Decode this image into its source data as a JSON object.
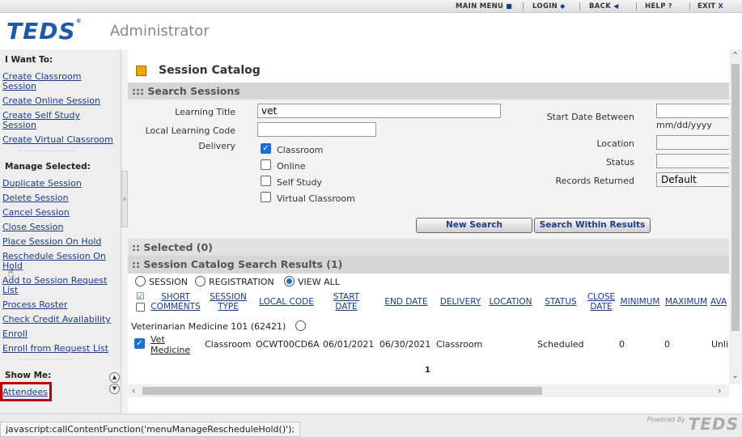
{
  "topnav": {
    "main_menu": "MAIN MENU",
    "logout": "LOGIN",
    "back": "BACK",
    "help": "HELP",
    "exit": "EXIT"
  },
  "header": {
    "logo": "TEDS",
    "subtitle": "Administrator"
  },
  "sidebar": {
    "i_want_to": "I Want To:",
    "create_items": [
      {
        "label": "Create Classroom Session"
      },
      {
        "label": "Create Online Session"
      },
      {
        "label": "Create Self Study Session"
      },
      {
        "label": "Create Virtual Classroom"
      }
    ],
    "dots": "..................",
    "manage_selected": "Manage Selected:",
    "manage_items": [
      {
        "label": "Duplicate Session"
      },
      {
        "label": "Delete Session"
      },
      {
        "label": "Cancel Session"
      },
      {
        "label": "Close Session"
      },
      {
        "label": "Place Session On Hold"
      },
      {
        "label": "Reschedule Session On Hold"
      },
      {
        "label": "Add to Session Request List"
      },
      {
        "label": "Process Roster"
      },
      {
        "label": "Check Credit Availability"
      },
      {
        "label": "Enroll"
      },
      {
        "label": "Enroll from Request List"
      }
    ],
    "show_me": "Show Me:",
    "show_items": [
      {
        "label": "Attendees"
      }
    ]
  },
  "main": {
    "title": "Session Catalog",
    "search_bar": "::: Search Sessions",
    "learning_title_label": "Learning Title",
    "learning_title_value": "vet",
    "local_code_label": "Local Learning Code",
    "local_code_value": "",
    "delivery_label": "Delivery",
    "delivery_options": [
      {
        "label": "Classroom",
        "checked": true
      },
      {
        "label": "Online",
        "checked": false
      },
      {
        "label": "Self Study",
        "checked": false
      },
      {
        "label": "Virtual Classroom",
        "checked": false
      }
    ],
    "start_date_label": "Start Date Between",
    "date_format": "mm/dd/yyyy",
    "location_label": "Location",
    "status_label": "Status",
    "records_label": "Records Returned",
    "records_value": "Default",
    "new_search": "New Search",
    "search_within": "Search Within Results",
    "selected_bar": ":: Selected (0)",
    "results_bar": ":: Session Catalog Search Results (1)",
    "view_options": [
      {
        "label": "SESSION",
        "selected": false
      },
      {
        "label": "REGISTRATION",
        "selected": false
      },
      {
        "label": "VIEW ALL",
        "selected": true
      }
    ],
    "columns": {
      "short_comments": "SHORT COMMENTS",
      "session_type": "SESSION TYPE",
      "local_code": "LOCAL CODE",
      "start_date": "START DATE",
      "end_date": "END DATE",
      "delivery": "DELIVERY",
      "location": "LOCATION",
      "status": "STATUS",
      "close_date": "CLOSE DATE",
      "minimum": "MINIMUM",
      "maximum": "MAXIMUM",
      "available": "AVA"
    },
    "group_label": "Veterinarian Medicine 101 (62421)",
    "row": {
      "title": "Vet Medicine",
      "session_type": "Classroom",
      "local_code": "OCWT00CD6A",
      "start_date": "06/01/2021",
      "end_date": "06/30/2021",
      "delivery": "Classroom",
      "status": "Scheduled",
      "minimum": "0",
      "maximum": "0",
      "available": "Unli"
    },
    "page": "1"
  },
  "statusbar": {
    "text": "javascript:callContentFunction('menuManageRescheduleHold()');"
  },
  "footer": {
    "powered": "Powered By",
    "logo": "TEDS"
  },
  "colors": {
    "brand": "#1e5aa8",
    "link": "#1a3c8a",
    "highlight_box": "#c00000",
    "accent_icon": "#f0a800"
  }
}
